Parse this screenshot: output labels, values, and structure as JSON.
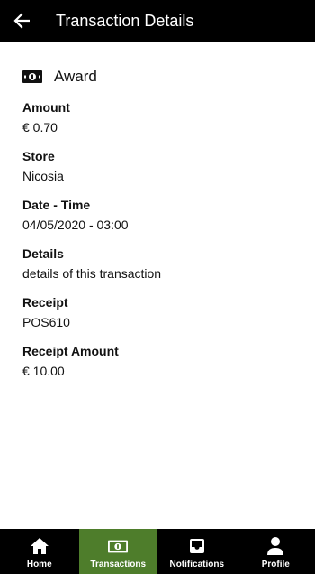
{
  "header": {
    "title": "Transaction Details",
    "back_icon": "arrow-left-icon"
  },
  "transaction": {
    "type_label": "Award",
    "type_icon": "money-bill-icon",
    "fields": [
      {
        "label": "Amount",
        "value": "€ 0.70"
      },
      {
        "label": "Store",
        "value": "Nicosia"
      },
      {
        "label": "Date - Time",
        "value": "04/05/2020 - 03:00"
      },
      {
        "label": "Details",
        "value": "details of this transaction"
      },
      {
        "label": "Receipt",
        "value": "POS610"
      },
      {
        "label": "Receipt Amount",
        "value": "€ 10.00"
      }
    ]
  },
  "bottom_nav": {
    "active_color": "#4e7d2b",
    "items": [
      {
        "label": "Home",
        "icon": "home-icon"
      },
      {
        "label": "Transactions",
        "icon": "money-bill-icon",
        "active": true
      },
      {
        "label": "Notifications",
        "icon": "inbox-icon"
      },
      {
        "label": "Profile",
        "icon": "user-icon"
      }
    ]
  }
}
